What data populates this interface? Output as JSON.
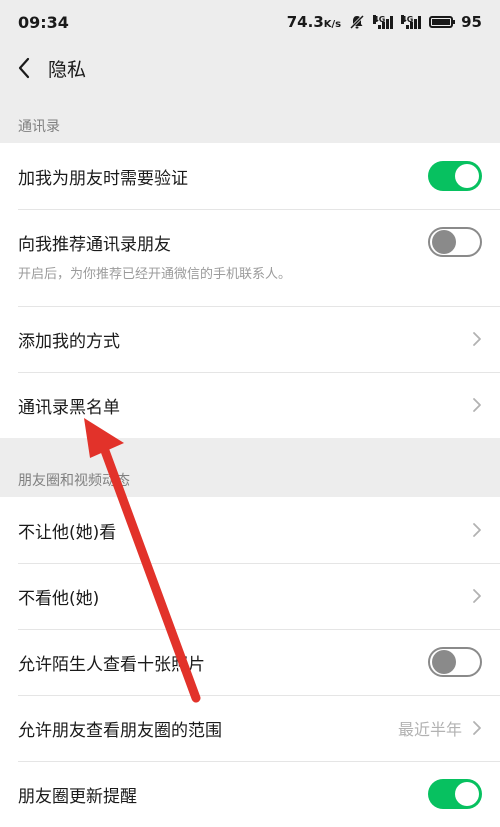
{
  "status": {
    "time": "09:34",
    "speed": "74.3",
    "speed_unit": "K/s",
    "sim1": "4G",
    "sim2": "4G",
    "battery": "95"
  },
  "nav": {
    "title": "隐私"
  },
  "sections": {
    "contacts": {
      "header": "通讯录",
      "verify_label": "加我为朋友时需要验证",
      "verify_on": true,
      "recommend_label": "向我推荐通讯录朋友",
      "recommend_on": false,
      "recommend_desc": "开启后，为你推荐已经开通微信的手机联系人。",
      "add_method_label": "添加我的方式",
      "blacklist_label": "通讯录黑名单"
    },
    "moments": {
      "header": "朋友圈和视频动态",
      "hide_from_label": "不让他(她)看",
      "dont_see_label": "不看他(她)",
      "stranger_label": "允许陌生人查看十张照片",
      "stranger_on": false,
      "range_label": "允许朋友查看朋友圈的范围",
      "range_value": "最近半年",
      "update_label": "朋友圈更新提醒",
      "update_on": true
    }
  },
  "colors": {
    "accent_green": "#07c160",
    "annotation_arrow": "#e2322a"
  },
  "icons": {
    "back": "chevron-left-icon",
    "row_arrow": "chevron-right-icon",
    "mute": "bell-off-icon",
    "signal": "signal-icon",
    "wifi": "wifi-icon",
    "battery": "battery-icon"
  }
}
